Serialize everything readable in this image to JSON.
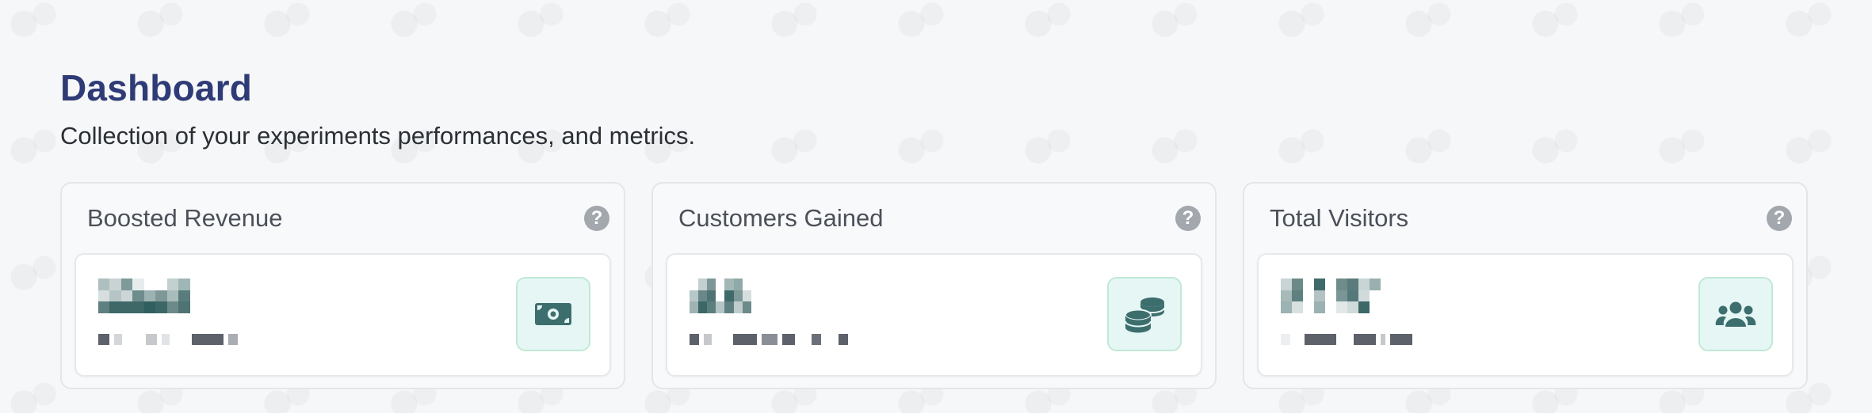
{
  "header": {
    "title": "Dashboard",
    "subtitle": "Collection of your experiments performances, and metrics."
  },
  "cards": [
    {
      "title": "Boosted Revenue",
      "help_icon": "question-circle-icon",
      "icon": "money-bill-icon"
    },
    {
      "title": "Customers Gained",
      "help_icon": "question-circle-icon",
      "icon": "coins-icon"
    },
    {
      "title": "Total Visitors",
      "help_icon": "question-circle-icon",
      "icon": "users-icon"
    }
  ],
  "colors": {
    "title": "#2f3b76",
    "icon_fill": "#3d6e6e",
    "icon_bg": "#e6f6f5",
    "icon_border": "#bfe9d6"
  }
}
